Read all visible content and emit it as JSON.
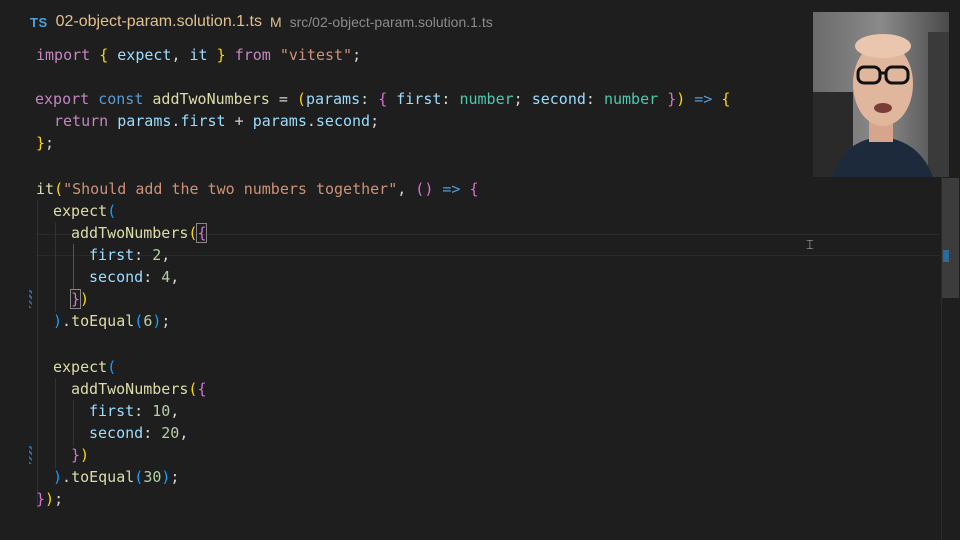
{
  "tab": {
    "language_badge": "TS",
    "file_name": "02-object-param.solution.1.ts",
    "modified_indicator": "M",
    "file_path": "src/02-object-param.solution.1.ts"
  },
  "code": {
    "l1_import": "import",
    "l1_expect": "expect",
    "l1_it": "it",
    "l1_from": "from",
    "l1_module": "\"vitest\"",
    "l3_export": "export",
    "l3_const": "const",
    "l3_fn": "addTwoNumbers",
    "l3_params": "params",
    "l3_first": "first",
    "l3_second": "second",
    "l3_type": "number",
    "l4_return": "return",
    "l4_params": "params",
    "l4_first": "first",
    "l4_second": "second",
    "l7_it": "it",
    "l7_desc": "\"Should add the two numbers together\"",
    "l8_expect": "expect",
    "l9_fn": "addTwoNumbers",
    "l10_first": "first",
    "l10_val": "2",
    "l11_second": "second",
    "l11_val": "4",
    "l13_toEqual": "toEqual",
    "l13_val": "6",
    "l15_expect": "expect",
    "l16_fn": "addTwoNumbers",
    "l17_first": "first",
    "l17_val": "10",
    "l18_second": "second",
    "l18_val": "20",
    "l20_toEqual": "toEqual",
    "l20_val": "30"
  },
  "colors": {
    "background": "#1e1e1e",
    "keyword": "#c586c0",
    "function": "#dcdcaa",
    "string": "#ce9178",
    "type": "#4ec9b0",
    "variable": "#9cdcfe"
  }
}
